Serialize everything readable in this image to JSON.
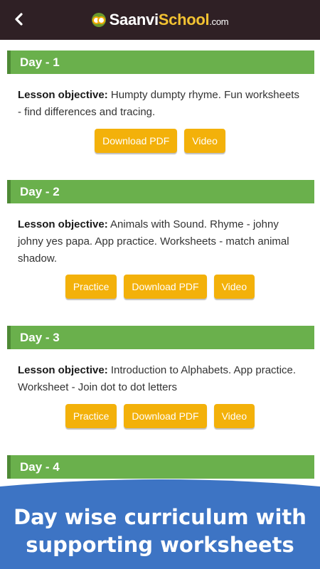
{
  "appbar": {
    "back_icon": "chevron-left-icon",
    "logo_part1": "Saanvi",
    "logo_part2": "School",
    "logo_suffix": ".com"
  },
  "days": [
    {
      "title": "Day - 1",
      "objective_label": "Lesson objective:",
      "objective_text": "Humpty dumpty rhyme. Fun worksheets - find differences and tracing.",
      "buttons": [
        "Download PDF",
        "Video"
      ]
    },
    {
      "title": "Day - 2",
      "objective_label": "Lesson objective:",
      "objective_text": "Animals with Sound. Rhyme - johny johny yes papa. App practice. Worksheets - match animal shadow.",
      "buttons": [
        "Practice",
        "Download PDF",
        "Video"
      ]
    },
    {
      "title": "Day - 3",
      "objective_label": "Lesson objective:",
      "objective_text": "Introduction to Alphabets. App practice. Worksheet - Join dot to dot letters",
      "buttons": [
        "Practice",
        "Download PDF",
        "Video"
      ]
    },
    {
      "title": "Day - 4"
    }
  ],
  "banner": {
    "line1": "Day wise curriculum with",
    "line2": "supporting worksheets"
  },
  "colors": {
    "appbar": "#2f2025",
    "day_header": "#6ab04c",
    "button": "#f3b10a",
    "banner": "#3d74c4"
  }
}
